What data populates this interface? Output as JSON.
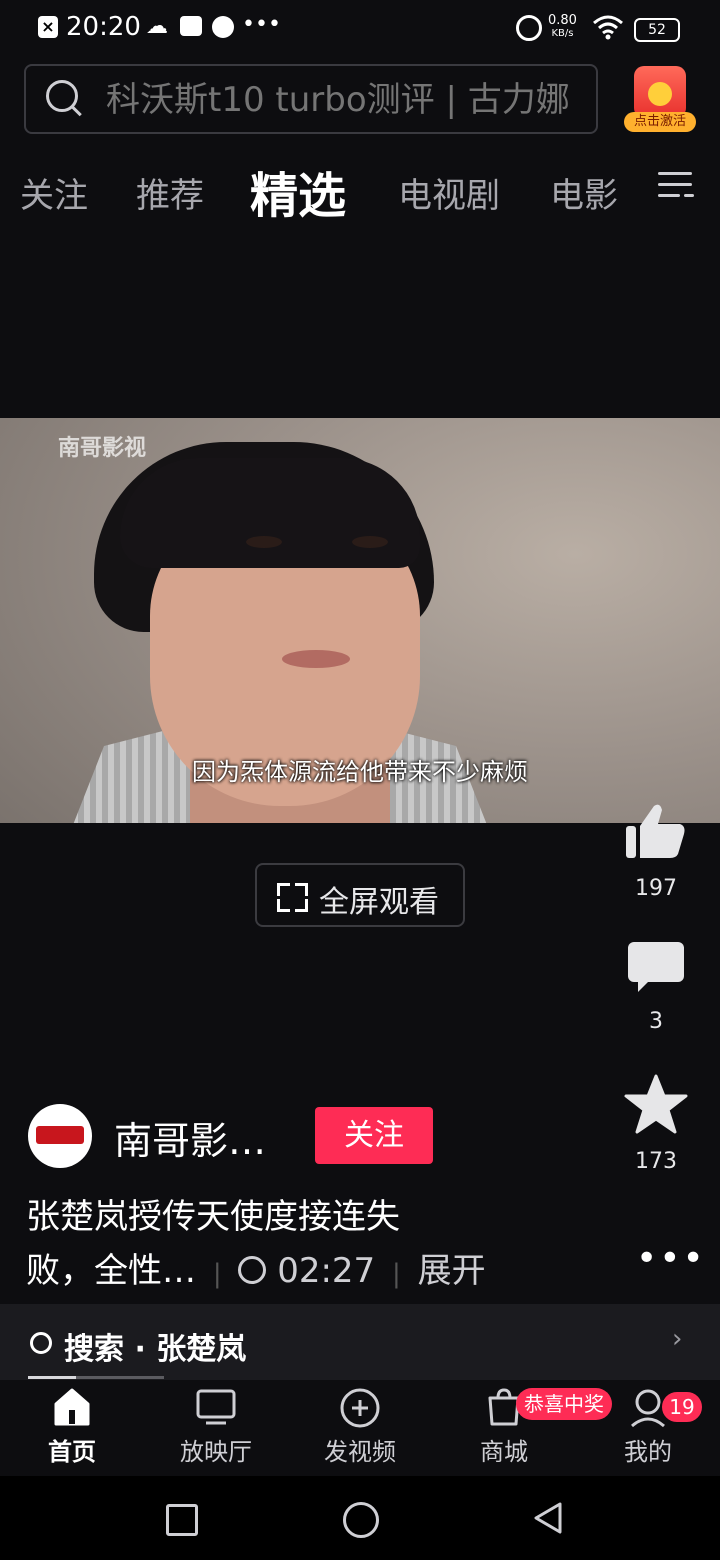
{
  "status_bar": {
    "time": "20:20",
    "net_speed": "0.80",
    "net_unit": "KB/s",
    "battery": "52",
    "icons": [
      "close-box-icon",
      "cloud-icon",
      "mail-icon",
      "voice-icon",
      "more-dots-icon",
      "alarm-icon",
      "wifi-icon",
      "battery-icon"
    ]
  },
  "search": {
    "placeholder": "科沃斯t10 turbo测评 | 古力娜"
  },
  "promo": {
    "label": "点击激活"
  },
  "tabs": [
    {
      "label": "关注",
      "active": false
    },
    {
      "label": "推荐",
      "active": false
    },
    {
      "label": "精选",
      "active": true
    },
    {
      "label": "电视剧",
      "active": false
    },
    {
      "label": "电影",
      "active": false
    }
  ],
  "video": {
    "watermark": "南哥影视",
    "subtitle": "因为炁体源流给他带来不少麻烦"
  },
  "fullscreen": {
    "label": "全屏观看"
  },
  "actions": {
    "likes": "197",
    "comments": "3",
    "favorites": "173"
  },
  "author": {
    "name": "南哥影…",
    "follow_label": "关注"
  },
  "description": {
    "line1": "张楚岚授传天使度接连失",
    "line2": "败，全性…",
    "duration": "02:27",
    "expand": "展开"
  },
  "related_search": {
    "label": "搜索 · 张楚岚"
  },
  "progress": 0.35,
  "bottom_nav": [
    {
      "label": "首页",
      "icon": "home-icon",
      "active": true
    },
    {
      "label": "放映厅",
      "icon": "tv-icon",
      "active": false
    },
    {
      "label": "发视频",
      "icon": "add-circle-icon",
      "active": false
    },
    {
      "label": "商城",
      "icon": "shopping-bag-icon",
      "active": false,
      "badge": "恭喜中奖"
    },
    {
      "label": "我的",
      "icon": "person-icon",
      "active": false,
      "badge": "19"
    }
  ],
  "colors": {
    "accent": "#fe2c55",
    "background": "#0d0d10"
  }
}
